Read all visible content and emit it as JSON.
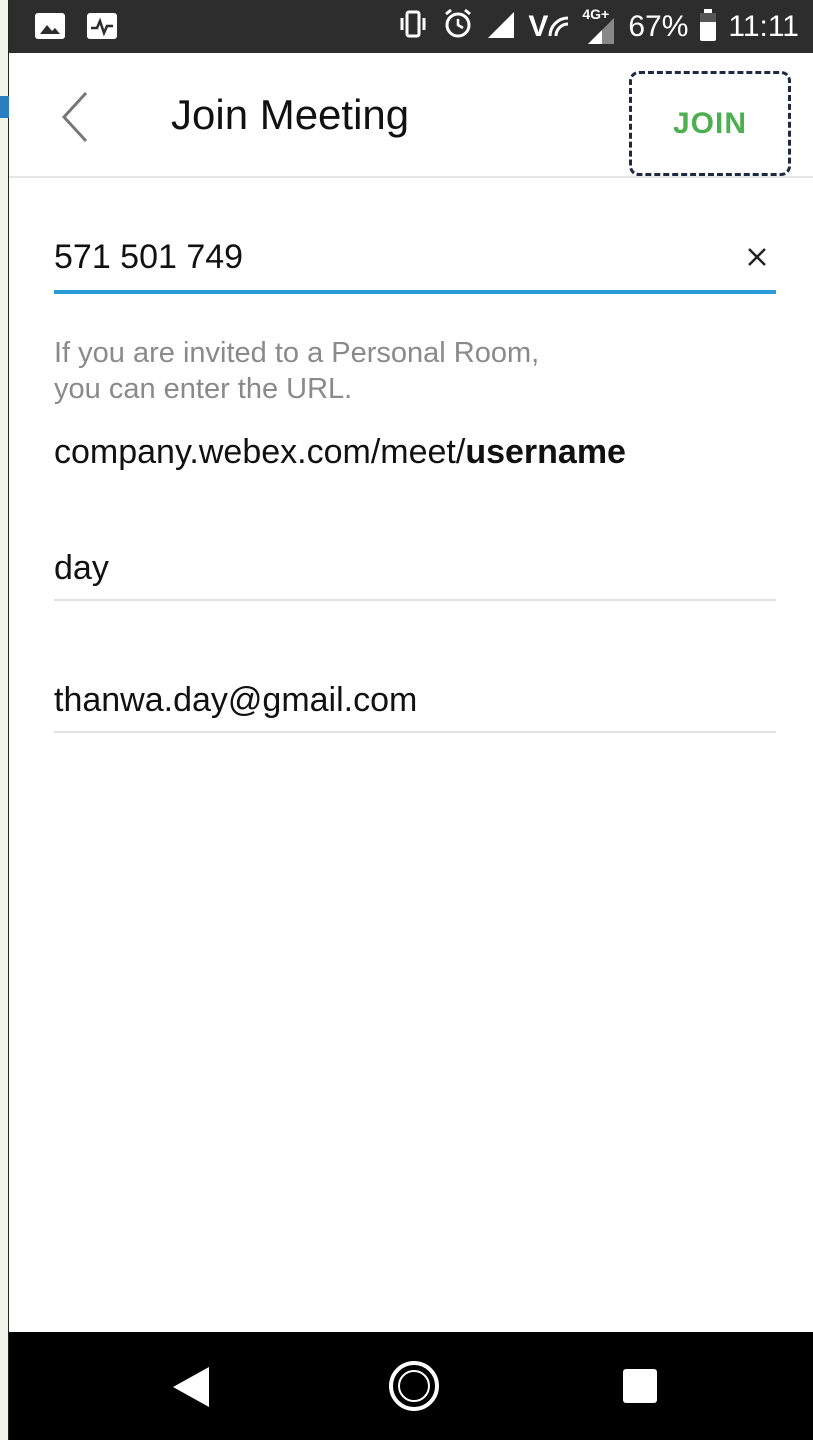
{
  "status_bar": {
    "icons_left": [
      "gallery-icon",
      "activity-icon"
    ],
    "icons_right": [
      "vibrate-icon",
      "alarm-icon",
      "signal-icon",
      "volte-icon",
      "4g-signal-icon",
      "battery-icon"
    ],
    "volte_text": "V",
    "network_text": "4G+",
    "battery": "67%",
    "time": "11:11"
  },
  "toolbar": {
    "back_icon": "chevron-left-icon",
    "title": "Join Meeting",
    "join_label": "JOIN"
  },
  "form": {
    "meeting_number": "571 501 749",
    "clear_icon": "close-icon",
    "hint_line1": "If you are invited to a Personal Room,",
    "hint_line2": "you can enter the URL.",
    "example_prefix": "company.webex.com/meet/",
    "example_bold": "username",
    "name_value": "day",
    "email_value": "thanwa.day@gmail.com"
  },
  "nav_bar": {
    "buttons": [
      "nav-back-icon",
      "nav-home-icon",
      "nav-recents-icon"
    ]
  },
  "colors": {
    "accent_blue": "#2a9bd6",
    "join_green": "#4caf50",
    "status_bar": "#2d2d2d",
    "nav_bar": "#000000"
  }
}
